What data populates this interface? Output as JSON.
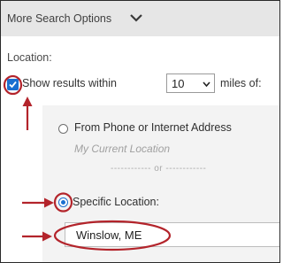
{
  "header": {
    "title": "More Search Options",
    "toggle_icon": "chevron-down-icon"
  },
  "location": {
    "label": "Location:",
    "show_results": {
      "checked": true,
      "text_before": "Show results within",
      "text_after": "miles of:"
    },
    "miles": {
      "value": "10"
    },
    "options": [
      {
        "label": "From Phone or Internet Address",
        "sublabel": "My Current Location",
        "selected": false
      },
      {
        "label": "Specific Location:",
        "selected": true
      }
    ],
    "separator": "------------ or ------------",
    "specific_location_value": "Winslow, ME"
  },
  "annotation_color": "#b3242b",
  "accent_color": "#1a6fd0"
}
